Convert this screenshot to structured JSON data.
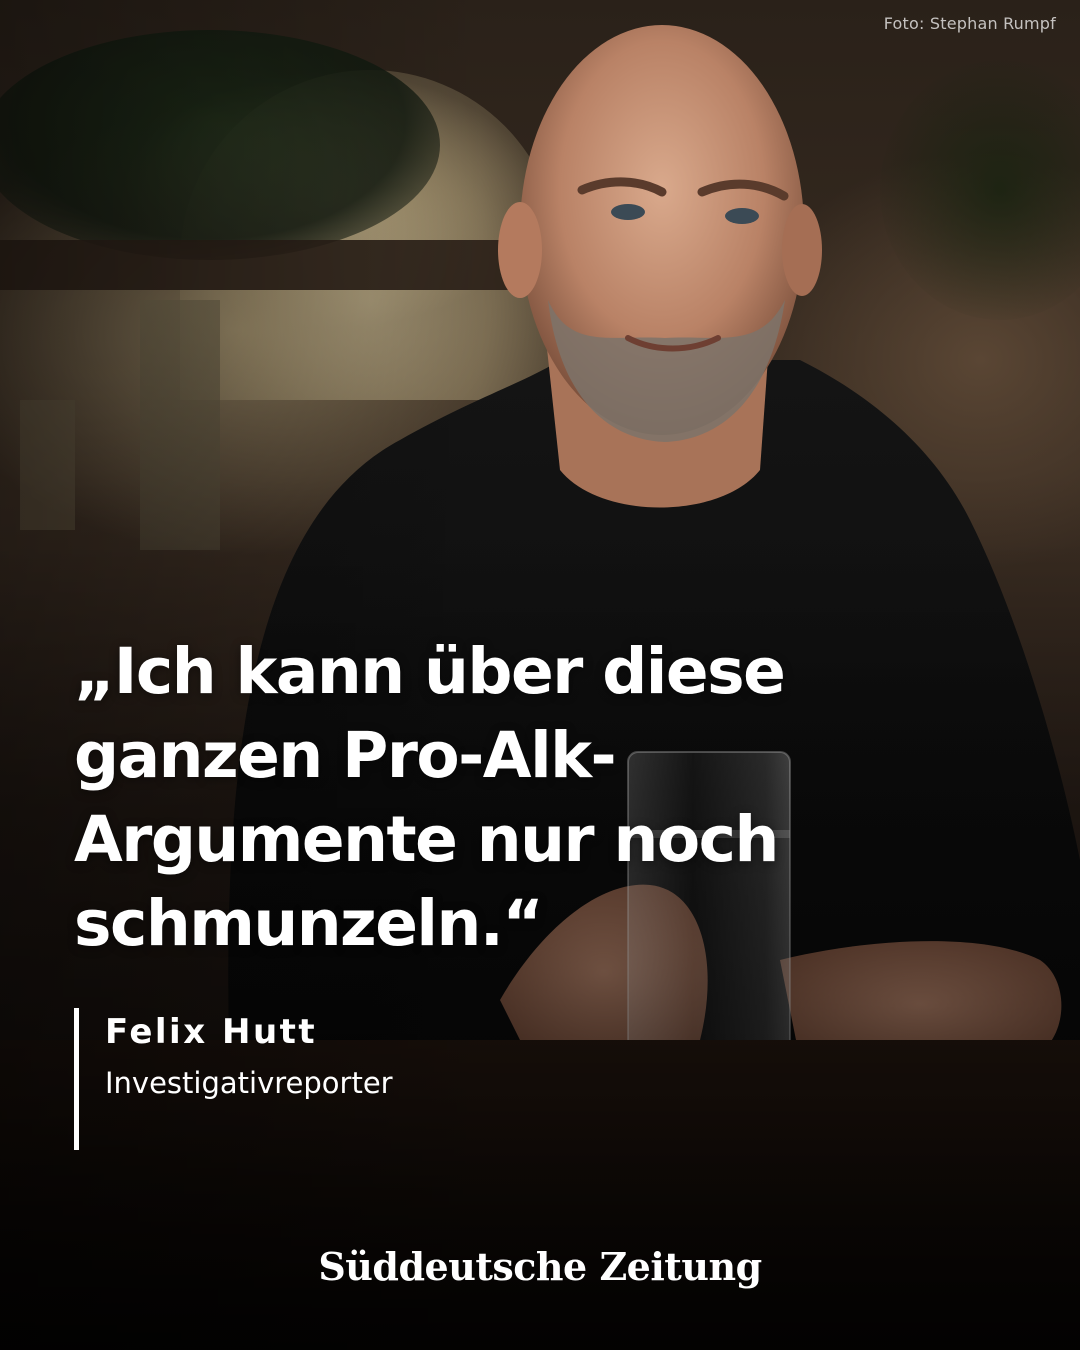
{
  "photo_credit": "Foto: Stephan Rumpf",
  "quote": {
    "text": "„Ich kann über diese ganzen Pro-Alk-Argumente nur noch schmunzeln.“"
  },
  "author": {
    "name": "Felix Hutt",
    "role": "Investigativreporter"
  },
  "brand": {
    "logo_text": "Süddeutsche Zeitung"
  },
  "colors": {
    "text": "#ffffff",
    "background": "#2a2119"
  }
}
